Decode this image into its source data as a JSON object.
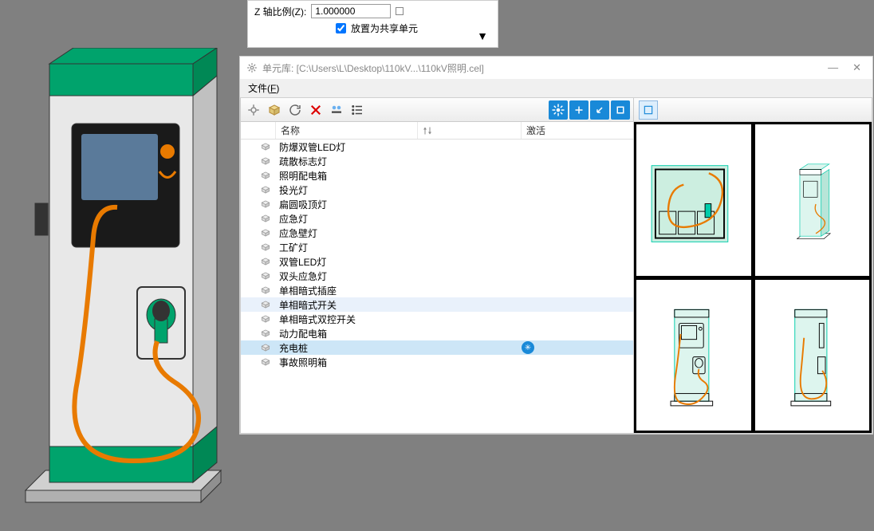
{
  "top_panel": {
    "z_label": "Z 轴比例(Z):",
    "z_value": "1.000000",
    "checkbox_label": "放置为共享单元"
  },
  "window": {
    "title": "单元库: [C:\\Users\\L\\Desktop\\110kV...\\110kV照明.cel]"
  },
  "menu": {
    "file": "文件(F)"
  },
  "list": {
    "header_name": "名称",
    "header_active": "激活",
    "items": [
      {
        "label": "防爆双管LED灯"
      },
      {
        "label": "疏散标志灯"
      },
      {
        "label": "照明配电箱"
      },
      {
        "label": "投光灯"
      },
      {
        "label": "扁圆吸顶灯"
      },
      {
        "label": "应急灯"
      },
      {
        "label": "应急壁灯"
      },
      {
        "label": "工矿灯"
      },
      {
        "label": "双管LED灯"
      },
      {
        "label": "双头应急灯"
      },
      {
        "label": "单相暗式插座"
      },
      {
        "label": "单相暗式开关",
        "hover": true
      },
      {
        "label": "单相暗式双控开关"
      },
      {
        "label": "动力配电箱"
      },
      {
        "label": "充电桩",
        "selected": true,
        "active": true
      },
      {
        "label": "事故照明箱"
      }
    ]
  }
}
